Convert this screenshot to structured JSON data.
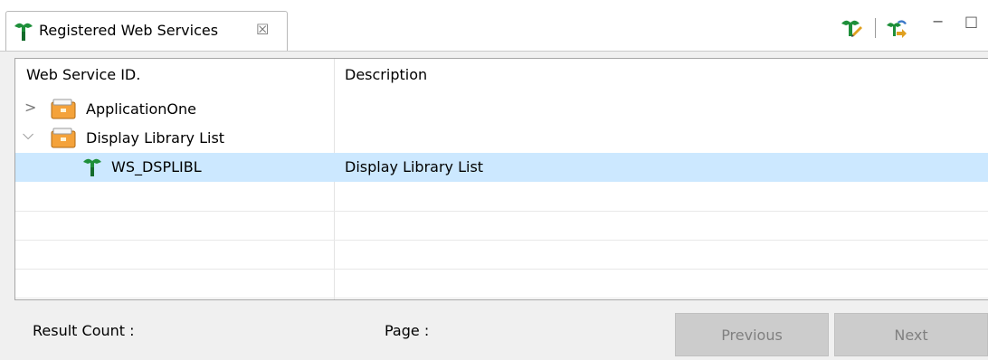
{
  "view": {
    "tab_title": "Registered Web Services",
    "tab_close_glyph": "☒",
    "minimize_glyph": "−",
    "maximize_glyph": "□"
  },
  "table": {
    "columns": [
      "Web Service ID.",
      "Description"
    ],
    "rows": [
      {
        "id": "ApplicationOne",
        "description": "",
        "level": 0,
        "expanded": false
      },
      {
        "id": "Display Library List",
        "description": "",
        "level": 0,
        "expanded": true
      },
      {
        "id": "WS_DSPLIBL",
        "description": "Display Library List",
        "level": 1,
        "selected": true
      }
    ],
    "expand_collapsed_glyph": ">",
    "expand_open_glyph": "⌵"
  },
  "footer": {
    "result_count_label": "Result Count :",
    "page_label": "Page :",
    "previous_label": "Previous",
    "next_label": "Next"
  },
  "icons": {
    "tab_icon": "web-service-icon",
    "toolbar": [
      "edit-service-icon",
      "refresh-service-icon",
      "minimize-icon",
      "maximize-icon"
    ],
    "folder_icon": "archive-folder-icon",
    "service_icon": "web-service-icon"
  },
  "colors": {
    "selection": "#cce8ff",
    "button_disabled_bg": "#cccccc",
    "button_disabled_text": "#808080",
    "service_icon_green": "#1e8f3a"
  }
}
